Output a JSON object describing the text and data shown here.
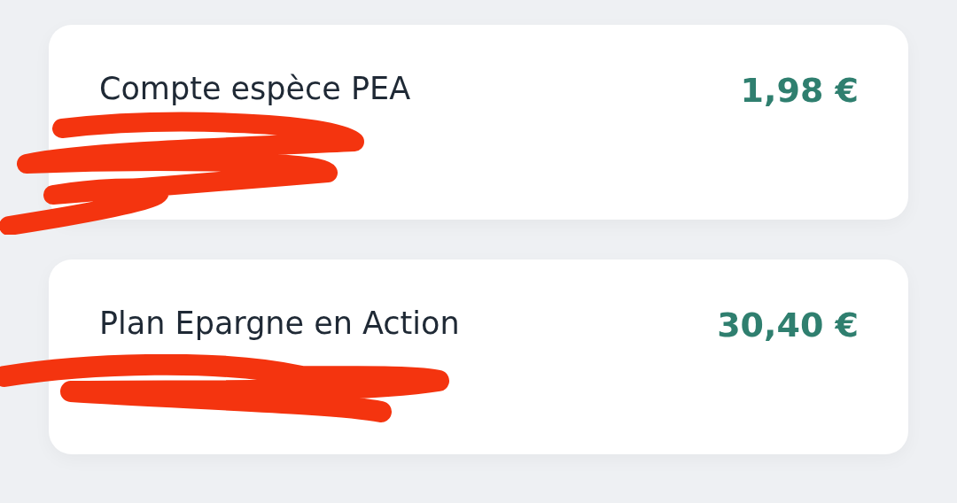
{
  "accounts": [
    {
      "name": "Compte espèce PEA",
      "balance": "1,98 €"
    },
    {
      "name": "Plan Epargne en Action",
      "balance": "30,40 €"
    }
  ]
}
